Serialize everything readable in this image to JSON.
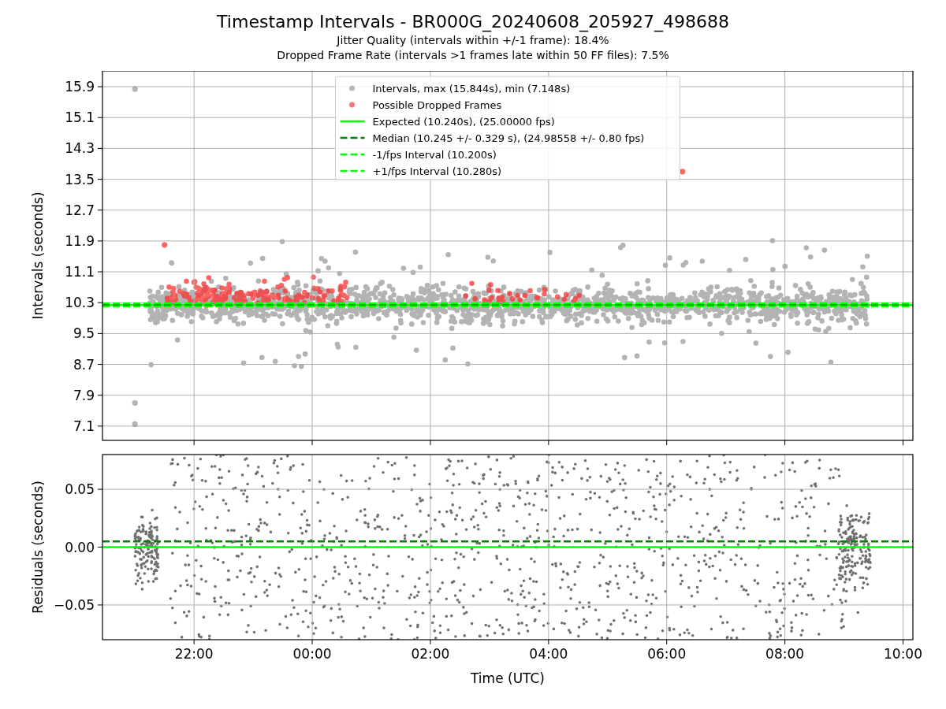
{
  "figure": {
    "title": "Timestamp Intervals - BR000G_20240608_205927_498688",
    "subtitles": [
      "Jitter Quality (intervals within +/-1 frame): 18.4%",
      "Dropped Frame Rate (intervals >1 frames late within 50 FF files): 7.5%"
    ]
  },
  "intervals_plot": {
    "chart_data": {
      "type": "scatter",
      "ylabel": "Intervals (seconds)",
      "grid": true,
      "legend": true,
      "xlim": [
        "2024-06-08T20:27",
        "2024-06-09T10:10"
      ],
      "ylim": [
        6.73,
        16.31
      ],
      "yticks": [
        {
          "value": 7.1,
          "label": "7.1"
        },
        {
          "value": 7.9,
          "label": "7.9"
        },
        {
          "value": 8.7,
          "label": "8.7"
        },
        {
          "value": 9.5,
          "label": "9.5"
        },
        {
          "value": 10.3,
          "label": "10.3"
        },
        {
          "value": 11.1,
          "label": "11.1"
        },
        {
          "value": 11.9,
          "label": "11.9"
        },
        {
          "value": 12.7,
          "label": "12.7"
        },
        {
          "value": 13.5,
          "label": "13.5"
        },
        {
          "value": 14.3,
          "label": "14.3"
        },
        {
          "value": 15.1,
          "label": "15.1"
        },
        {
          "value": 15.9,
          "label": "15.9"
        }
      ],
      "x": [
        "2024-06-08T21:00",
        "2024-06-08T21:00",
        "2024-06-08T21:00",
        "2024-06-08T21:30",
        "2024-06-09T06:16"
      ],
      "series": [
        {
          "name": "Intervals, max (15.844s), min (7.148s)",
          "color": "#808080",
          "values": [
            15.84,
            7.7,
            7.15,
            null,
            null
          ]
        },
        {
          "name": "Possible Dropped Frames",
          "color": "#ff0000",
          "values": [
            null,
            null,
            null,
            11.8,
            13.7
          ]
        }
      ],
      "ref_lines": [
        {
          "axis": "y",
          "value": 10.24,
          "label": "Expected (10.240s), (25.00000 fps)",
          "color": "#00ff00",
          "line_style": "solid"
        },
        {
          "axis": "y",
          "value": 10.245,
          "label": "Median (10.245 +/- 0.329 s), (24.98558 +/- 0.80 fps)",
          "color": "#008000",
          "line_style": "dashed"
        },
        {
          "axis": "y",
          "value": 10.2,
          "label": "-1/fps Interval (10.200s)",
          "color": "#00ff00",
          "line_style": "dashed"
        },
        {
          "axis": "y",
          "value": 10.28,
          "label": "+1/fps Interval (10.280s)",
          "color": "#00ff00",
          "line_style": "dashed"
        }
      ]
    }
  },
  "residuals_plot": {
    "chart_data": {
      "type": "line",
      "xlabel": "Time (UTC)",
      "ylabel": "Residuals (seconds)",
      "grid": true,
      "xlim": [
        "2024-06-08T20:27",
        "2024-06-09T10:10"
      ],
      "ylim": [
        -0.08,
        0.08
      ],
      "xticks": [
        {
          "value": "2024-06-08T22:00",
          "label": "22:00"
        },
        {
          "value": "2024-06-09T00:00",
          "label": "00:00"
        },
        {
          "value": "2024-06-09T02:00",
          "label": "02:00"
        },
        {
          "value": "2024-06-09T04:00",
          "label": "04:00"
        },
        {
          "value": "2024-06-09T06:00",
          "label": "06:00"
        },
        {
          "value": "2024-06-09T08:00",
          "label": "08:00"
        },
        {
          "value": "2024-06-09T10:00",
          "label": "10:00"
        }
      ],
      "yticks": [
        {
          "value": 0.05,
          "label": "0.05"
        },
        {
          "value": 0,
          "label": "0.00"
        },
        {
          "value": -0.05,
          "label": "−0.05"
        }
      ],
      "x": [
        "2024-06-08T20:27",
        "2024-06-09T10:10"
      ],
      "series": [
        {
          "color": "#00ff00",
          "line_style": "solid",
          "values": [
            0,
            0
          ]
        },
        {
          "color": "#008000",
          "line_style": "dashed",
          "values": [
            0.005,
            0.005
          ]
        }
      ]
    }
  }
}
